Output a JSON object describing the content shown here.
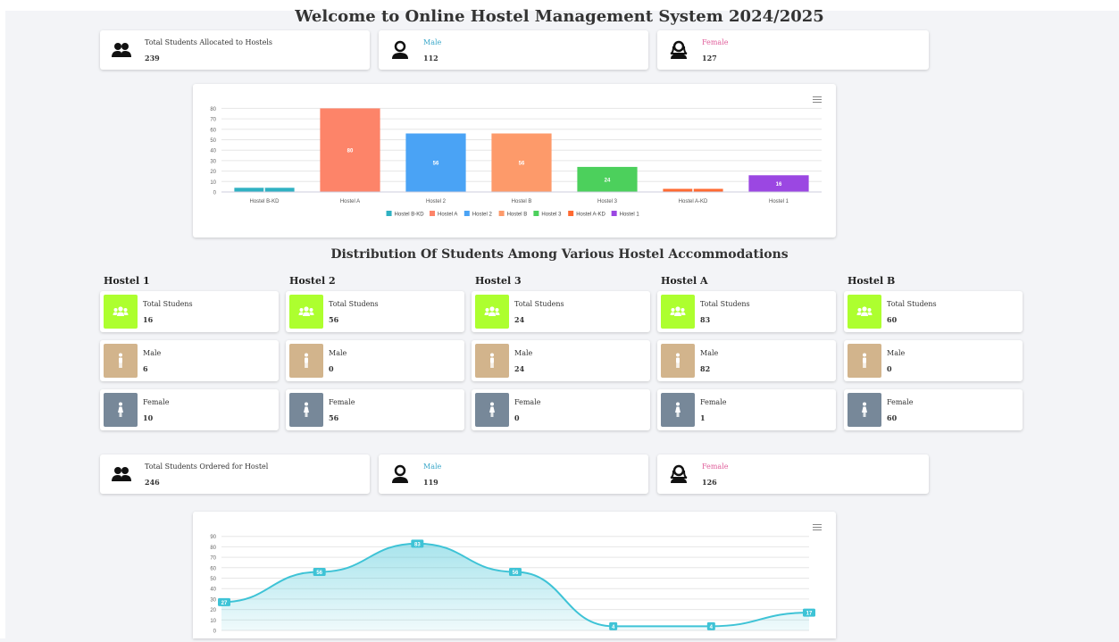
{
  "title": "Welcome to Online Hostel Management System 2024/2025",
  "allocated": {
    "total_label": "Total Students Allocated to Hostels",
    "total_value": "239",
    "male_label": "Male",
    "male_value": "112",
    "female_label": "Female",
    "female_value": "127"
  },
  "distribution_title": "Distribution Of Students Among Various Hostel Accommodations",
  "hostels": [
    {
      "name": "Hostel 1",
      "total_label": "Total Studens",
      "total": "16",
      "male_label": "Male",
      "male": "6",
      "female_label": "Female",
      "female": "10"
    },
    {
      "name": "Hostel 2",
      "total_label": "Total Studens",
      "total": "56",
      "male_label": "Male",
      "male": "0",
      "female_label": "Female",
      "female": "56"
    },
    {
      "name": "Hostel 3",
      "total_label": "Total Studens",
      "total": "24",
      "male_label": "Male",
      "male": "24",
      "female_label": "Female",
      "female": "0"
    },
    {
      "name": "Hostel A",
      "total_label": "Total Studens",
      "total": "83",
      "male_label": "Male",
      "male": "82",
      "female_label": "Female",
      "female": "1"
    },
    {
      "name": "Hostel B",
      "total_label": "Total Studens",
      "total": "60",
      "male_label": "Male",
      "male": "0",
      "female_label": "Female",
      "female": "60"
    }
  ],
  "ordered": {
    "total_label": "Total Students Ordered for Hostel",
    "total_value": "246",
    "male_label": "Male",
    "male_value": "119",
    "female_label": "Female",
    "female_value": "126"
  },
  "colors": {
    "total_square": "#adff2f",
    "male_square": "#d2b48c",
    "female_square": "#778899",
    "male_text": "#3aa7c9",
    "female_text": "#e0609c",
    "area_line": "#3ec3d6"
  },
  "chart_data": [
    {
      "type": "bar",
      "categories": [
        "Hostel B-KD",
        "Hostel A",
        "Hostel 2",
        "Hostel B",
        "Hostel 3",
        "Hostel A-KD",
        "Hostel 1"
      ],
      "values": [
        4,
        80,
        56,
        56,
        24,
        3,
        16
      ],
      "colors": [
        "#2fb1c2",
        "#fd8469",
        "#4aa3f5",
        "#fd9a6a",
        "#4cd05c",
        "#ff6a32",
        "#9b47e2"
      ],
      "data_labels": [
        "",
        "80",
        "56",
        "56",
        "24",
        "",
        "16"
      ],
      "legend": [
        "Hostel B-KD",
        "Hostel A",
        "Hostel 2",
        "Hostel B",
        "Hostel 3",
        "Hostel A-KD",
        "Hostel 1"
      ],
      "legend_position": "bottom",
      "yticks": [
        0,
        10,
        20,
        30,
        40,
        50,
        60,
        70,
        80
      ],
      "ylim": [
        0,
        90
      ],
      "grid": true
    },
    {
      "type": "area",
      "points": [
        27,
        56,
        83,
        56,
        4,
        4,
        17
      ],
      "point_labels": [
        "27",
        "56",
        "83",
        "56",
        "4",
        "4",
        "17"
      ],
      "yticks": [
        0,
        10,
        20,
        30,
        40,
        50,
        60,
        70,
        80,
        90
      ],
      "ylim": [
        0,
        90
      ],
      "grid": true
    }
  ]
}
